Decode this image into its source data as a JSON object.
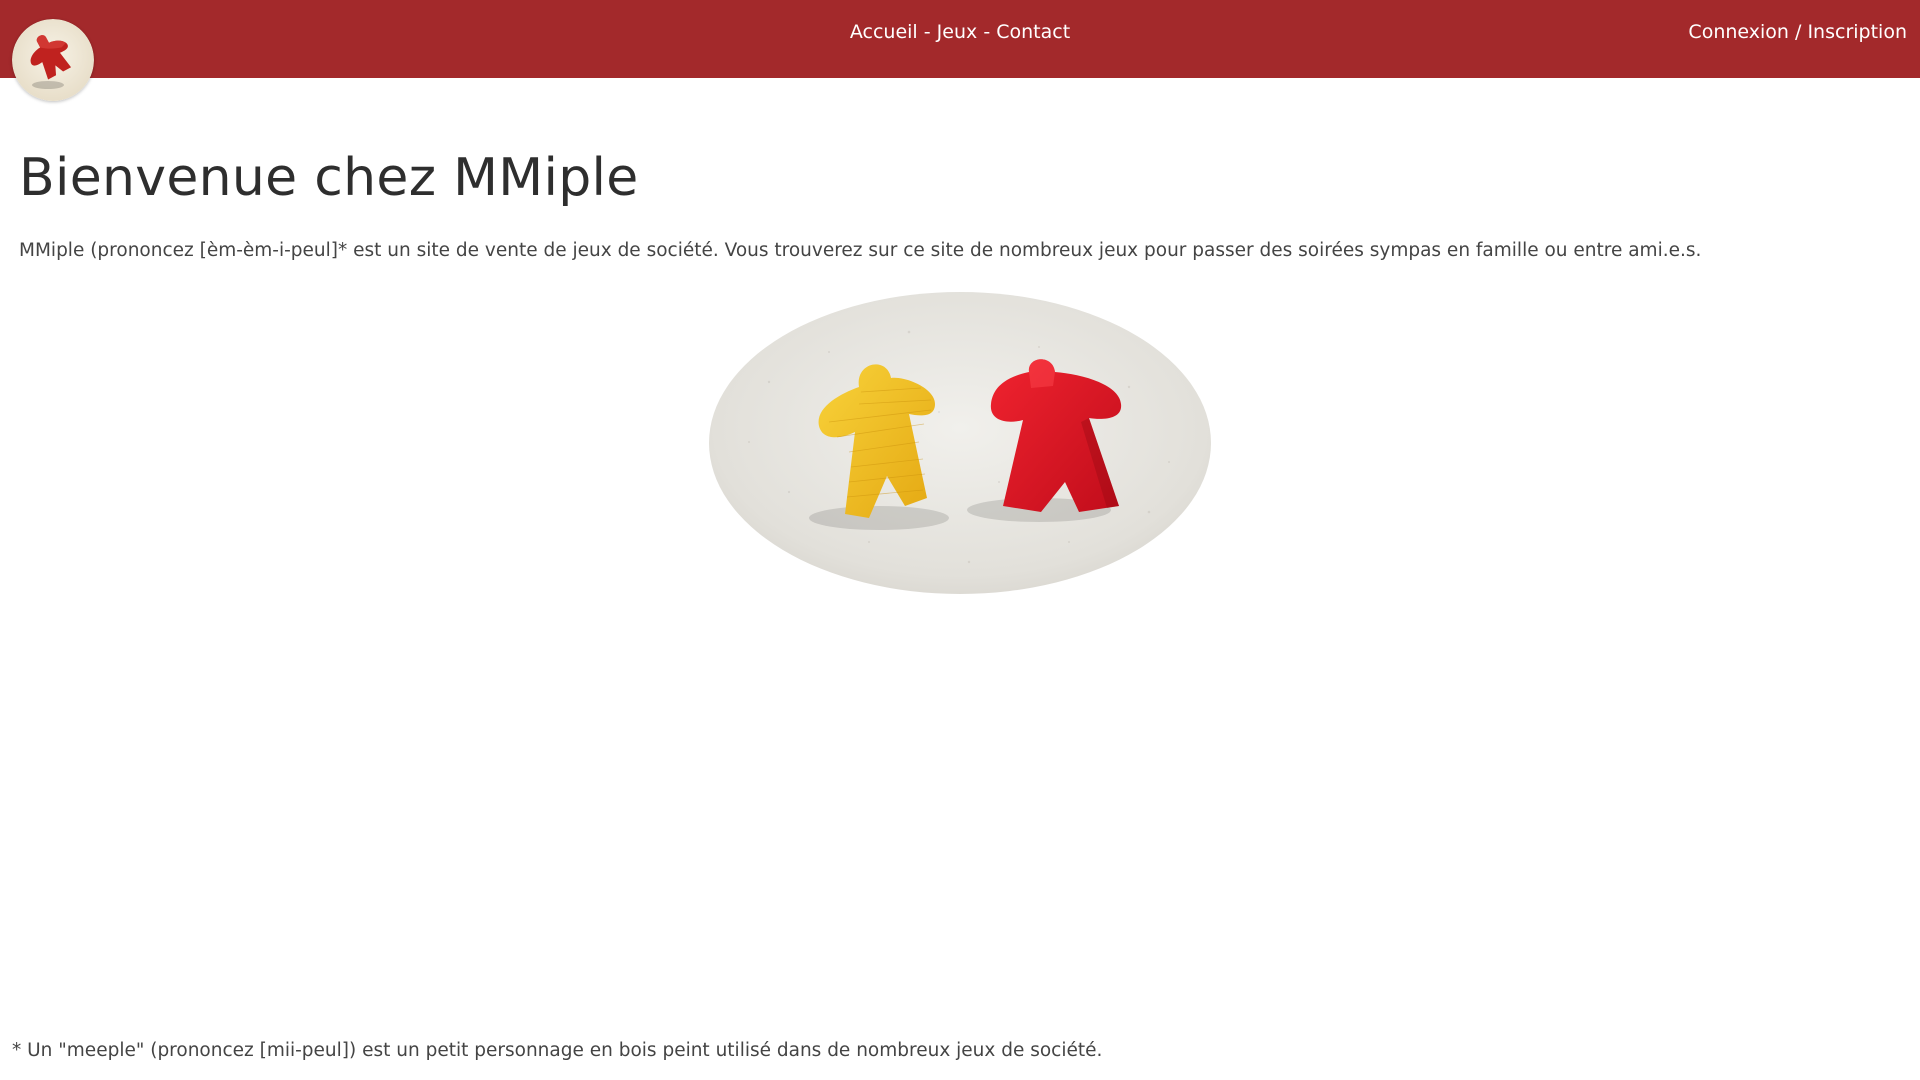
{
  "header": {
    "logo_icon": "meeple-logo-icon",
    "nav": {
      "home": "Accueil",
      "games": "Jeux",
      "contact": "Contact",
      "separator": "-"
    },
    "auth": {
      "login": "Connexion",
      "separator": "/",
      "signup": "Inscription"
    },
    "bar_color": "#a3292b"
  },
  "main": {
    "title": "Bienvenue chez MMiple",
    "intro": "MMiple (prononcez [èm-èm-i-peul]* est un site de vente de jeux de société. Vous trouverez sur ce site de nombreux jeux pour passer des soirées sympas en famille ou entre ami.e.s.",
    "hero_image": "yellow-and-red-meeples-photo"
  },
  "footer": {
    "footnote": "* Un \"meeple\" (prononcez [mii-peul]) est un petit personnage en bois peint utilisé dans de nombreux jeux de société."
  }
}
